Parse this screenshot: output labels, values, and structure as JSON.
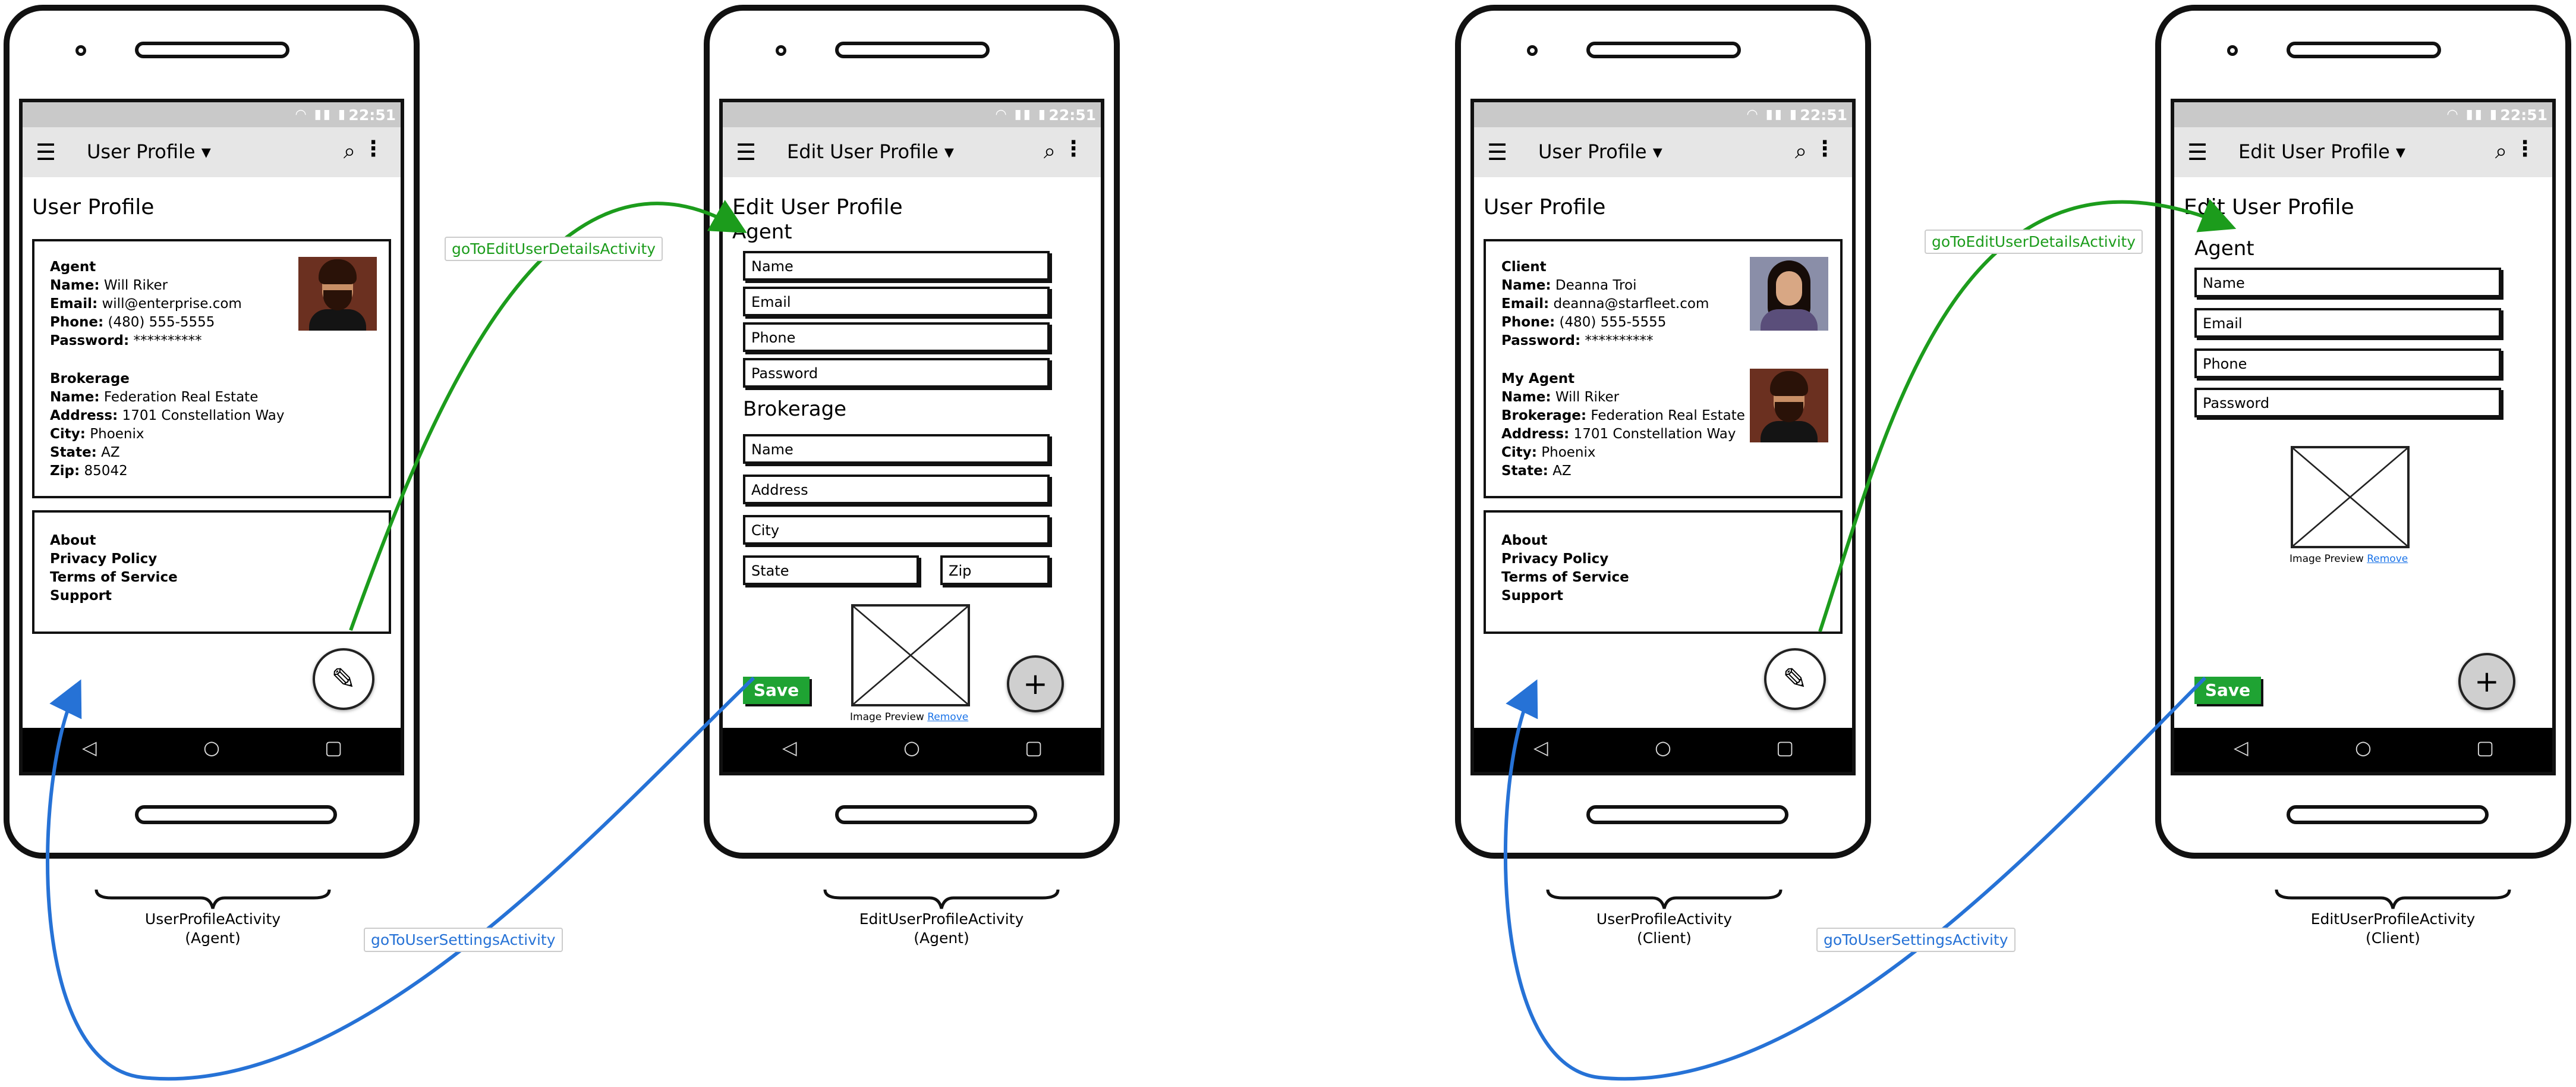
{
  "status_time": "22:51",
  "phones": [
    {
      "id": "user-profile-agent",
      "app_title": "User Profile",
      "heading": "User Profile",
      "card1": [
        {
          "bold": "Agent",
          "text": ""
        },
        {
          "bold": "Name:",
          "text": " Will Riker"
        },
        {
          "bold": "Email:",
          "text": " will@enterprise.com"
        },
        {
          "bold": "Phone:",
          "text": " (480) 555-5555"
        },
        {
          "bold": "Password:",
          "text": " **********"
        },
        {
          "bold": "",
          "text": ""
        },
        {
          "bold": "Brokerage",
          "text": ""
        },
        {
          "bold": "Name:",
          "text": " Federation Real Estate"
        },
        {
          "bold": "Address:",
          "text": " 1701 Constellation Way"
        },
        {
          "bold": "City:",
          "text": " Phoenix"
        },
        {
          "bold": "State:",
          "text": " AZ"
        },
        {
          "bold": "Zip:",
          "text": " 85042"
        }
      ],
      "card2": [
        "About",
        "Privacy Policy",
        "Terms of Service",
        "Support"
      ],
      "caption": [
        "UserProfileActivity",
        "(Agent)"
      ]
    },
    {
      "id": "edit-user-profile-agent",
      "app_title": "Edit User Profile",
      "heading": "Edit User Profile",
      "agent_label": "Agent",
      "agent_fields": [
        "Name",
        "Email",
        "Phone",
        "Password"
      ],
      "brokerage_label": "Brokerage",
      "brokerage_fields": [
        "Name",
        "Address",
        "City",
        "State",
        "Zip"
      ],
      "save_label": "Save",
      "preview_text": "Image Preview",
      "remove_link": "Remove",
      "caption": [
        "EditUserProfileActivity",
        "(Agent)"
      ]
    },
    {
      "id": "user-profile-client",
      "app_title": "User Profile",
      "heading": "User Profile",
      "card1": [
        {
          "bold": "Client",
          "text": ""
        },
        {
          "bold": "Name:",
          "text": " Deanna Troi"
        },
        {
          "bold": "Email:",
          "text": " deanna@starfleet.com"
        },
        {
          "bold": "Phone:",
          "text": " (480) 555-5555"
        },
        {
          "bold": "Password:",
          "text": " **********"
        },
        {
          "bold": "",
          "text": ""
        },
        {
          "bold": "My Agent",
          "text": ""
        },
        {
          "bold": "Name:",
          "text": " Will Riker"
        },
        {
          "bold": "Brokerage:",
          "text": " Federation Real Estate"
        },
        {
          "bold": "Address:",
          "text": " 1701 Constellation Way"
        },
        {
          "bold": "City:",
          "text": " Phoenix"
        },
        {
          "bold": "State:",
          "text": " AZ"
        }
      ],
      "card2": [
        "About",
        "Privacy Policy",
        "Terms of Service",
        "Support"
      ],
      "caption": [
        "UserProfileActivity",
        "(Client)"
      ]
    },
    {
      "id": "edit-user-profile-client",
      "app_title": "Edit User Profile",
      "heading": "Edit User Profile",
      "agent_label": "Agent",
      "agent_fields": [
        "Name",
        "Email",
        "Phone",
        "Password"
      ],
      "save_label": "Save",
      "preview_text": "Image Preview",
      "remove_link": "Remove",
      "caption": [
        "EditUserProfileActivity",
        "(Client)"
      ]
    }
  ],
  "arrows": {
    "edit_label": "goToEditUserDetailsActivity",
    "settings_label": "goToUserSettingsActivity",
    "edit_color": "#1c9c1c",
    "settings_color": "#2672d6"
  },
  "icons": {
    "menu": "menu-icon",
    "dropdown": "dropdown-arrow-icon",
    "search": "search-icon",
    "more": "more-vert-icon",
    "pencil": "pencil-icon",
    "plus": "plus-icon",
    "back": "back-nav-icon",
    "home": "home-nav-icon",
    "recents": "recents-nav-icon"
  }
}
